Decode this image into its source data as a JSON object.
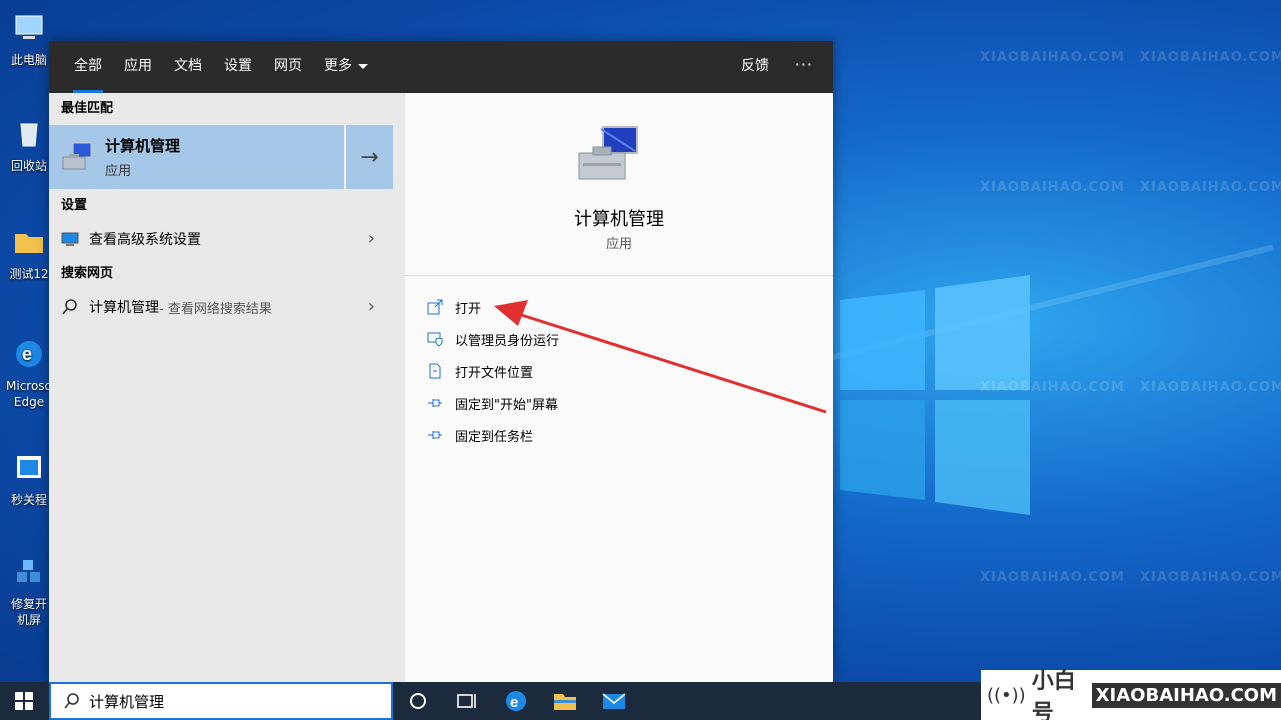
{
  "desktop": {
    "icons": [
      {
        "label": "此电脑"
      },
      {
        "label": "回收站"
      },
      {
        "label": "测试12"
      },
      {
        "label": "Microsoft Edge"
      },
      {
        "label": "秒关程"
      },
      {
        "label": "修复开机屏"
      }
    ],
    "watermark_cn": "@小白号",
    "watermark_en": "XIAOBAIHAO.COM"
  },
  "search_panel": {
    "tabs": [
      {
        "label": "全部",
        "active": true
      },
      {
        "label": "应用"
      },
      {
        "label": "文档"
      },
      {
        "label": "设置"
      },
      {
        "label": "网页"
      },
      {
        "label": "更多"
      }
    ],
    "feedback_label": "反馈",
    "more_options": "···",
    "best_match_header": "最佳匹配",
    "best_match": {
      "title": "计算机管理",
      "subtitle": "应用"
    },
    "settings_header": "设置",
    "settings_item": "查看高级系统设置",
    "web_header": "搜索网页",
    "web_item": {
      "query": "计算机管理",
      "hint": " - 查看网络搜索结果"
    },
    "detail": {
      "title": "计算机管理",
      "subtitle": "应用",
      "actions": [
        {
          "label": "打开",
          "icon": "open-icon"
        },
        {
          "label": "以管理员身份运行",
          "icon": "shield-icon"
        },
        {
          "label": "打开文件位置",
          "icon": "file-location-icon"
        },
        {
          "label": "固定到\"开始\"屏幕",
          "icon": "pin-icon"
        },
        {
          "label": "固定到任务栏",
          "icon": "pin-icon"
        }
      ]
    }
  },
  "taskbar": {
    "search_value": "计算机管理"
  },
  "brand": {
    "signal": "((•))",
    "cn": "小白号",
    "en": "XIAOBAIHAO.COM"
  },
  "colors": {
    "accent": "#1a73d9",
    "highlight": "#a6c8e8",
    "annotation_arrow": "#e03030"
  }
}
